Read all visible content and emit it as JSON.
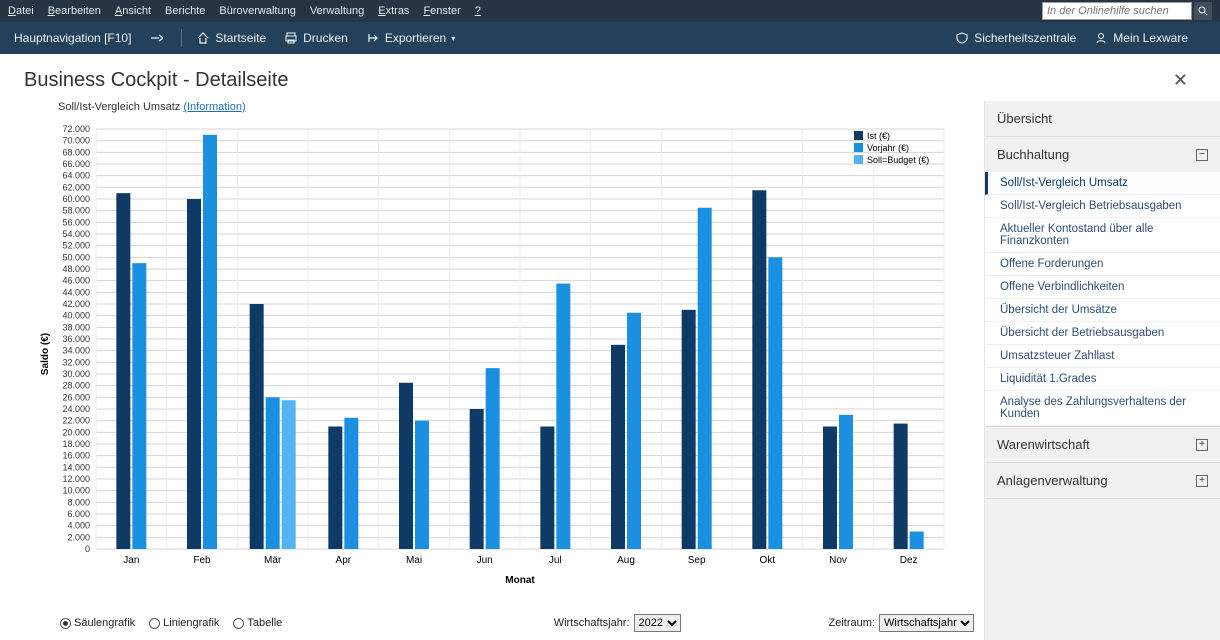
{
  "menubar": {
    "items": [
      "Datei",
      "Bearbeiten",
      "Ansicht",
      "Berichte",
      "Büroverwaltung",
      "Verwaltung",
      "Extras",
      "Fenster",
      "?"
    ],
    "search_placeholder": "In der Onlinehilfe suchen"
  },
  "toolbar": {
    "nav_label": "Hauptnavigation [F10]",
    "startseite": "Startseite",
    "drucken": "Drucken",
    "exportieren": "Exportieren",
    "sicherheit": "Sicherheitszentrale",
    "mein": "Mein Lexware"
  },
  "page": {
    "title": "Business Cockpit - Detailseite",
    "subtitle_label": "Soll/Ist-Vergleich Umsatz",
    "information": "(Information)"
  },
  "chart_data": {
    "type": "bar",
    "title": "",
    "xlabel": "Monat",
    "ylabel": "Saldo (€)",
    "ylim": [
      0,
      72000
    ],
    "ytick_step": 2000,
    "categories": [
      "Jan",
      "Feb",
      "Mär",
      "Apr",
      "Mai",
      "Jun",
      "Jul",
      "Aug",
      "Sep",
      "Okt",
      "Nov",
      "Dez"
    ],
    "series": [
      {
        "name": "Ist (€)",
        "color": "#0f3a66",
        "values": [
          61000,
          60000,
          42000,
          21000,
          28500,
          24000,
          21000,
          35000,
          41000,
          61500,
          21000,
          21500
        ]
      },
      {
        "name": "Vorjahr (€)",
        "color": "#1b8fe0",
        "values": [
          49000,
          71000,
          26000,
          22500,
          22000,
          31000,
          45500,
          40500,
          58500,
          50000,
          23000,
          3000
        ]
      },
      {
        "name": "Soll=Budget (€)",
        "color": "#54b4f2",
        "values": [
          null,
          null,
          25500,
          null,
          null,
          null,
          null,
          null,
          null,
          null,
          null,
          null
        ]
      }
    ],
    "legend_position": "top-right"
  },
  "controls": {
    "view_radios": [
      "Säulengrafik",
      "Liniengrafik",
      "Tabelle"
    ],
    "view_selected": 0,
    "wirtschaftsjahr_label": "Wirtschaftsjahr:",
    "wirtschaftsjahr_value": "2022",
    "zeitraum_label": "Zeitraum:",
    "zeitraum_value": "Wirtschaftsjahr"
  },
  "sidebar": {
    "overview": "Übersicht",
    "sections": [
      {
        "title": "Buchhaltung",
        "expanded": true,
        "items": [
          "Soll/Ist-Vergleich Umsatz",
          "Soll/Ist-Vergleich Betriebsausgaben",
          "Aktueller Kontostand über alle Finanzkonten",
          "Offene Forderungen",
          "Offene Verbindlichkeiten",
          "Übersicht der Umsätze",
          "Übersicht der Betriebsausgaben",
          "Umsatzsteuer Zahllast",
          "Liquidität 1.Grades",
          "Analyse des Zahlungsverhaltens der Kunden"
        ],
        "active_index": 0
      },
      {
        "title": "Warenwirtschaft",
        "expanded": false
      },
      {
        "title": "Anlagenverwaltung",
        "expanded": false
      }
    ]
  }
}
